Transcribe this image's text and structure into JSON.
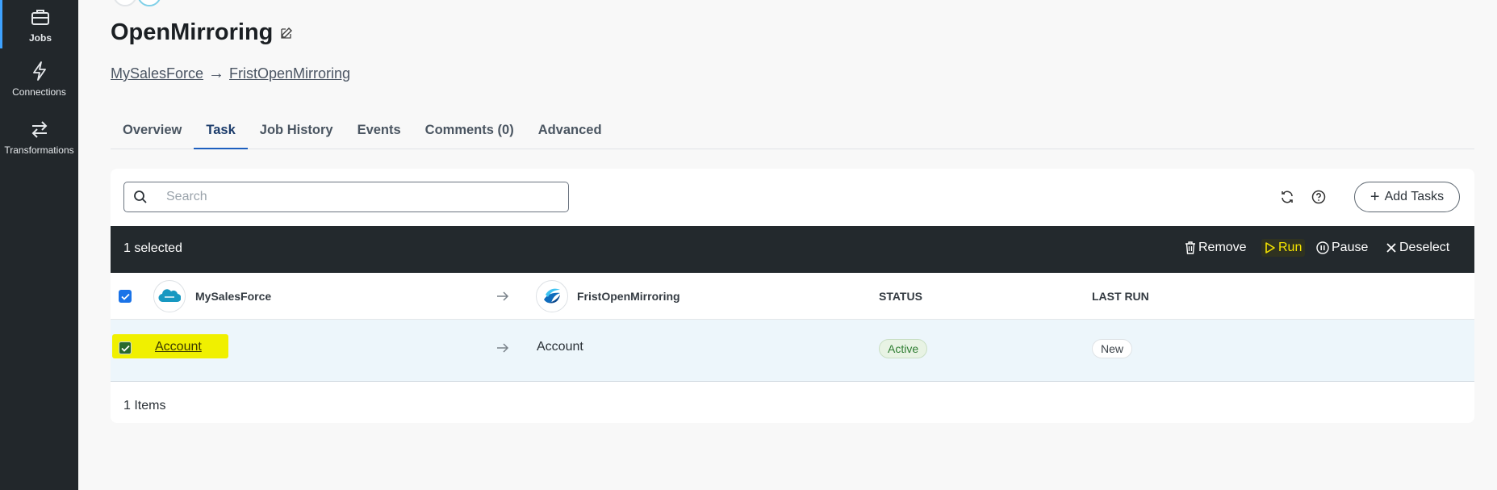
{
  "sidebar": {
    "items": [
      {
        "label": "Jobs",
        "icon": "briefcase-icon",
        "active": true
      },
      {
        "label": "Connections",
        "icon": "lightning-icon",
        "active": false
      },
      {
        "label": "Transformations",
        "icon": "swap-arrows-icon",
        "active": false
      }
    ]
  },
  "header": {
    "title": "OpenMirroring",
    "source_link": "MySalesForce",
    "target_link": "FristOpenMirroring"
  },
  "tabs": [
    {
      "label": "Overview",
      "active": false
    },
    {
      "label": "Task",
      "active": true
    },
    {
      "label": "Job History",
      "active": false
    },
    {
      "label": "Events",
      "active": false
    },
    {
      "label": "Comments (0)",
      "active": false
    },
    {
      "label": "Advanced",
      "active": false
    }
  ],
  "search": {
    "placeholder": "Search",
    "value": ""
  },
  "toolbar": {
    "add_tasks_label": "Add Tasks"
  },
  "selection_bar": {
    "count_text": "1 selected",
    "remove_label": "Remove",
    "run_label": "Run",
    "pause_label": "Pause",
    "deselect_label": "Deselect"
  },
  "table": {
    "source_header": "MySalesForce",
    "target_header": "FristOpenMirroring",
    "status_header": "STATUS",
    "last_run_header": "LAST RUN",
    "rows": [
      {
        "source": "Account",
        "target": "Account",
        "status": "Active",
        "last_run": "New",
        "checked": true
      }
    ]
  },
  "footer": {
    "items_count": "1 Items"
  },
  "colors": {
    "sidebar_bg": "#22272b",
    "accent": "#1a73e8",
    "selection_bar_bg": "#23292d",
    "run_highlight": "#f5e400",
    "row_highlight": "#f0f000",
    "active_badge": "#2e7d32"
  }
}
